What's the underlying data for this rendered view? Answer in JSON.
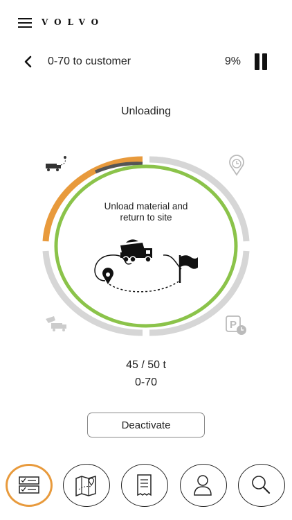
{
  "header": {
    "brand": "VOLVO"
  },
  "route": {
    "title": "0-70 to customer",
    "progress_text": "9%"
  },
  "activity": {
    "status": "Unloading",
    "instruction_line1": "Unload material and",
    "instruction_line2": "return to site",
    "load": "45 / 50 t",
    "code": "0-70",
    "progress": 0.09
  },
  "actions": {
    "deactivate_label": "Deactivate"
  },
  "colors": {
    "accent": "#e89a3c",
    "ring_active": "#8bc34a",
    "ring_inactive": "#d6d6d6"
  },
  "nav": {
    "items": [
      {
        "icon": "checklist-icon",
        "active": true
      },
      {
        "icon": "map-icon",
        "active": false
      },
      {
        "icon": "receipt-icon",
        "active": false
      },
      {
        "icon": "profile-icon",
        "active": false
      },
      {
        "icon": "search-icon",
        "active": false
      }
    ]
  }
}
